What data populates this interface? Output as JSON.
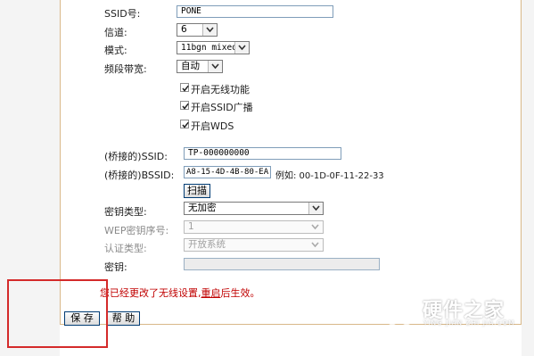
{
  "form": {
    "ssid_label": "SSID号:",
    "ssid_value": "PONE",
    "channel_label": "信道:",
    "channel_value": "6",
    "mode_label": "模式:",
    "mode_value": "11bgn mixed",
    "bandwidth_label": "频段带宽:",
    "bandwidth_value": "自动",
    "enable_wireless_label": "开启无线功能",
    "enable_wireless_checked": true,
    "enable_ssid_broadcast_label": "开启SSID广播",
    "enable_ssid_broadcast_checked": true,
    "enable_wds_label": "开启WDS",
    "enable_wds_checked": true
  },
  "bridge": {
    "bridged_ssid_label": "(桥接的)SSID:",
    "bridged_ssid_value": "TP-000000000",
    "bridged_bssid_label": "(桥接的)BSSID:",
    "bridged_bssid_value": "A8-15-4D-4B-80-EA",
    "bssid_example": "例如: 00-1D-0F-11-22-33",
    "scan_button": "扫描",
    "key_type_label": "密钥类型:",
    "key_type_value": "无加密",
    "wep_index_label": "WEP密钥序号:",
    "wep_index_value": "1",
    "auth_type_label": "认证类型:",
    "auth_type_value": "开放系统",
    "key_label": "密钥:",
    "key_value": ""
  },
  "notice": {
    "before": "您已经更改了无线设置,",
    "link": "重启",
    "after": "后生效。"
  },
  "actions": {
    "save_label": "保 存",
    "help_label": "帮 助"
  },
  "watermark": {
    "title": "硬件之家",
    "subtitle": "YING JIAN ZHI JIA.COM"
  },
  "colors": {
    "notice_red": "#c00000",
    "highlight_box": "#d42a2a",
    "panel_border": "#d9b889"
  }
}
